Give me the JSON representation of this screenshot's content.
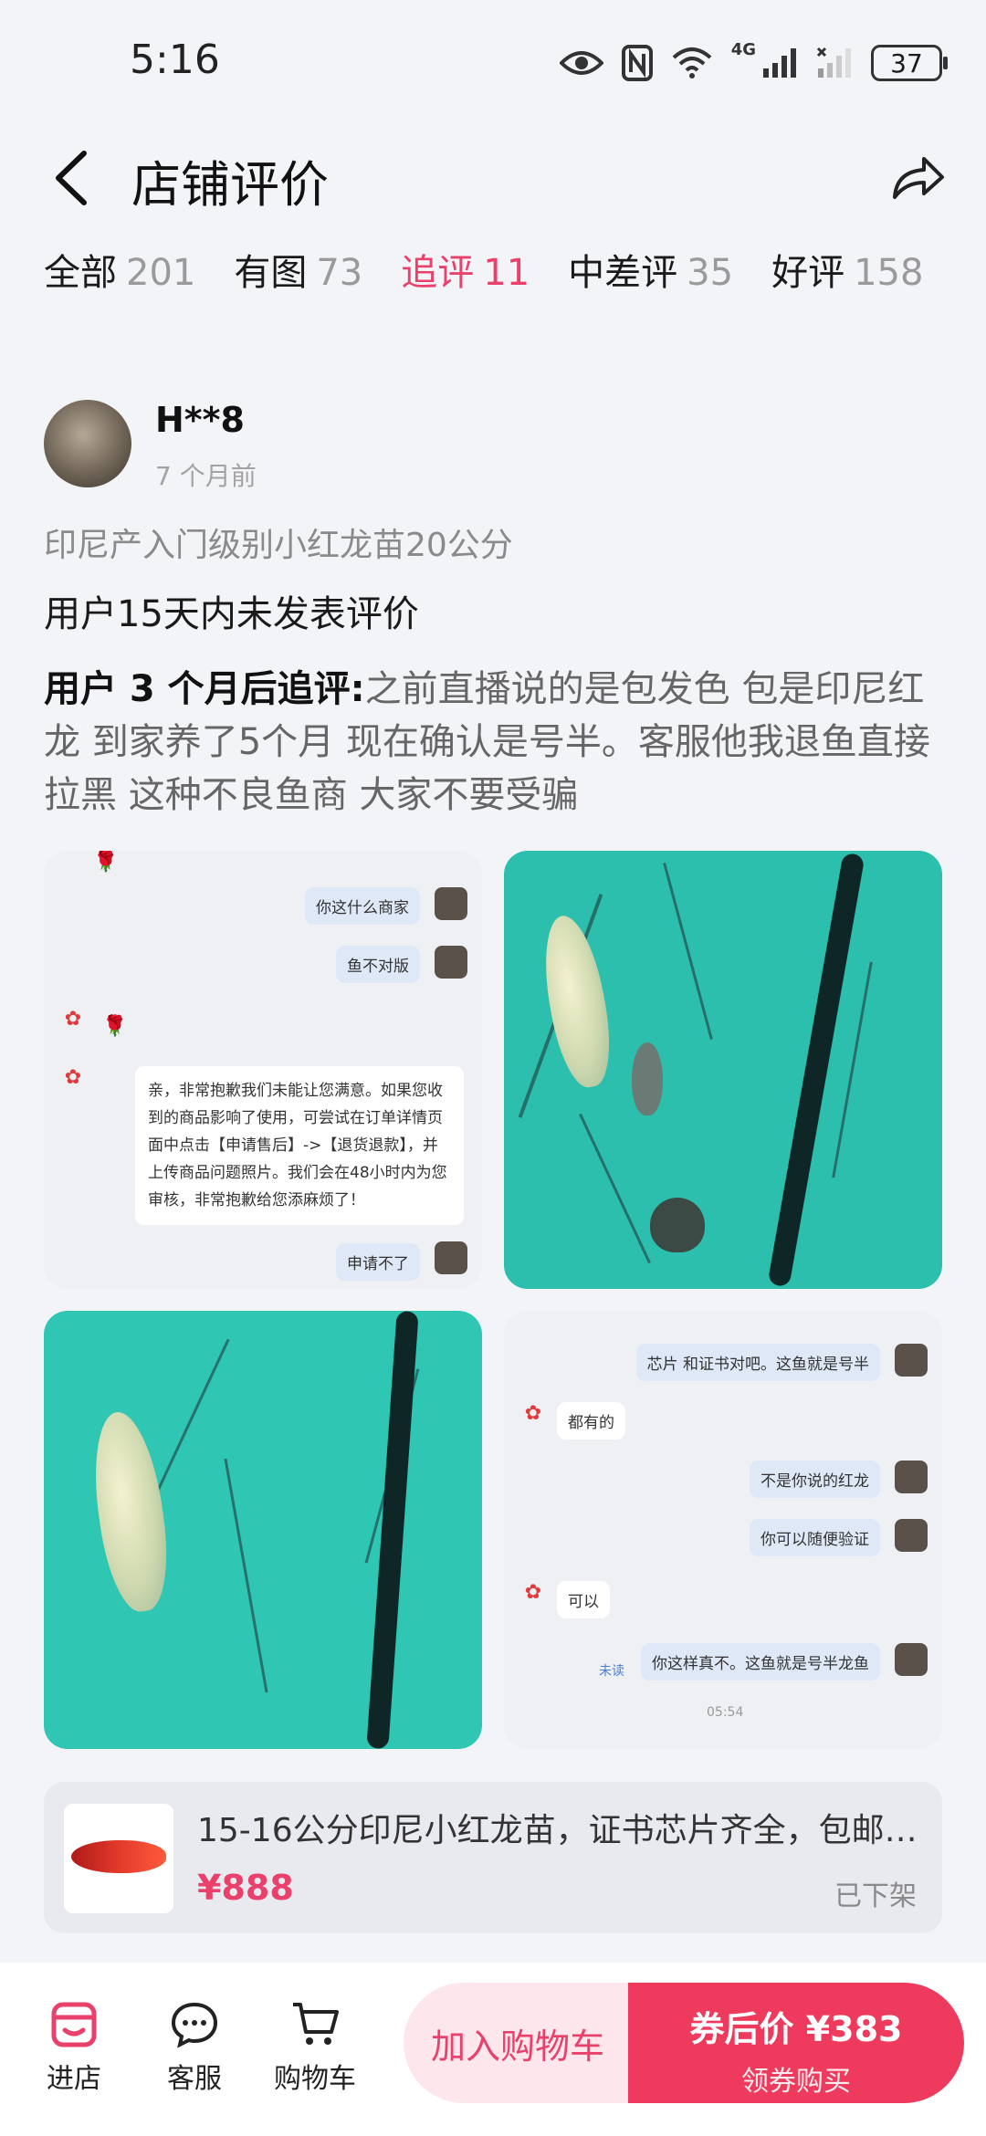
{
  "status_bar": {
    "time": "5:16",
    "battery": "37",
    "network": "4G"
  },
  "header": {
    "title": "店铺评价"
  },
  "tabs": [
    {
      "label": "全部",
      "count": "201"
    },
    {
      "label": "有图",
      "count": "73"
    },
    {
      "label": "追评",
      "count": "11"
    },
    {
      "label": "中差评",
      "count": "35"
    },
    {
      "label": "好评",
      "count": "158"
    }
  ],
  "review": {
    "user_name": "H**8",
    "time_ago": "7 个月前",
    "product_spec": "印尼产入门级别小红龙苗20公分",
    "no_review_text": "用户15天内未发表评价",
    "follow_up_prefix": "用户 3 个月后追评:",
    "follow_up_text": "之前直播说的是包发色 包是印尼红龙 到家养了5个月 现在确认是号半。客服他我退鱼直接拉黑 这种不良鱼商 大家不要受骗",
    "chat1": {
      "msg1": "你这什么商家",
      "msg2": "鱼不对版",
      "shop_reply": "亲，非常抱歉我们未能让您满意。如果您收到的商品影响了使用，可尝试在订单详情页面中点击【申请售后】->【退货退款】，并上传商品问题照片。我们会在48小时内为您审核，非常抱歉给您添麻烦了！",
      "msg3": "申请不了"
    },
    "chat2": {
      "msg1": "芯片 和证书对吧。这鱼就是号半",
      "reply1": "都有的",
      "msg2": "不是你说的红龙",
      "msg3": "你可以随便验证",
      "reply2": "可以",
      "msg4": "你这样真不。这鱼就是号半龙鱼",
      "unread": "未读",
      "timestamp": "05:54"
    }
  },
  "product": {
    "title": "15-16公分印尼小红龙苗，证书芯片齐全，包邮…",
    "price": "¥888",
    "status": "已下架"
  },
  "bottom_bar": {
    "store": "进店",
    "service": "客服",
    "cart": "购物车",
    "add_cart": "加入购物车",
    "coupon_price": "券后价 ¥383",
    "coupon_buy": "领券购买"
  },
  "colors": {
    "accent": "#e9416b",
    "buy_button": "#ee3a5c",
    "cart_button_bg": "#fde7ec"
  }
}
